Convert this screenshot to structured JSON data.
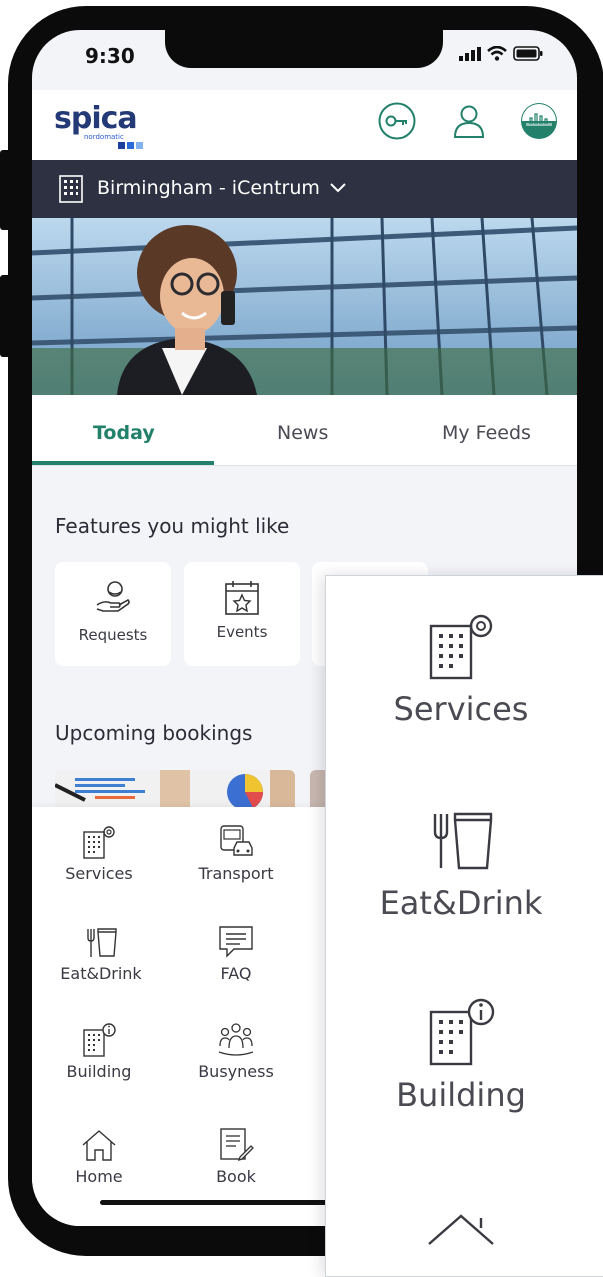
{
  "status": {
    "time": "9:30"
  },
  "brand": {
    "name": "spica",
    "sub": "nordomatic"
  },
  "header": {
    "icons": [
      "key-icon",
      "user-icon",
      "building-avatar-icon"
    ]
  },
  "location": {
    "label": "Birmingham - iCentrum"
  },
  "tabs": [
    {
      "label": "Today"
    },
    {
      "label": "News"
    },
    {
      "label": "My Feeds"
    }
  ],
  "features": {
    "title": "Features you might like",
    "items": [
      {
        "label": "Requests",
        "icon": "requests-hand-icon"
      },
      {
        "label": "Events",
        "icon": "calendar-star-icon"
      }
    ]
  },
  "bookings": {
    "title": "Upcoming bookings"
  },
  "menu": {
    "items": [
      {
        "label": "Services",
        "icon": "building-gear-icon"
      },
      {
        "label": "Transport",
        "icon": "bus-car-icon"
      },
      {
        "label": "Eat&Drink",
        "icon": "fork-cup-icon"
      },
      {
        "label": "FAQ",
        "icon": "chat-icon"
      },
      {
        "label": "Building",
        "icon": "building-info-icon"
      },
      {
        "label": "Busyness",
        "icon": "people-icon"
      },
      {
        "label": "Home",
        "icon": "home-icon"
      },
      {
        "label": "Book",
        "icon": "book-pen-icon"
      }
    ]
  },
  "panel": {
    "items": [
      {
        "label": "Services",
        "icon": "building-gear-icon"
      },
      {
        "label": "Eat&Drink",
        "icon": "fork-cup-icon"
      },
      {
        "label": "Building",
        "icon": "building-info-icon"
      }
    ]
  },
  "colors": {
    "accent": "#23806a",
    "brand": "#233a77",
    "locbar": "#2d3141"
  }
}
